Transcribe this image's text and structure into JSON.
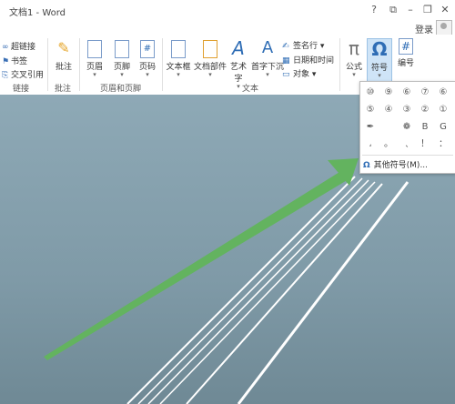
{
  "window": {
    "title": "文档1 - Word",
    "controls": [
      "?",
      "⧉",
      "–",
      "❐",
      "✕"
    ],
    "login": "登录"
  },
  "ribbon": {
    "links": {
      "items": [
        "超链接",
        "书签",
        "交叉引用"
      ],
      "group": "链接"
    },
    "comments": {
      "button": "批注",
      "group": "批注"
    },
    "header_footer": {
      "buttons": [
        "页眉",
        "页脚",
        "页码"
      ],
      "group": "页眉和页脚"
    },
    "text": {
      "buttons": [
        "文本框",
        "文档部件",
        "艺术字",
        "首字下沉"
      ],
      "group": "文本"
    },
    "text_right": {
      "items": [
        "签名行",
        "日期和时间",
        "对象"
      ]
    },
    "symbols": {
      "buttons": [
        "公式",
        "符号",
        "编号"
      ]
    }
  },
  "symbol_panel": {
    "symbols": [
      "⑩",
      "⑨",
      "⑥",
      "⑦",
      "⑥",
      "⑤",
      "④",
      "③",
      "②",
      "①",
      "✒",
      "",
      "❁",
      "B",
      "G",
      "،",
      "。",
      "﹑",
      "！",
      "："
    ],
    "more_label": "其他符号(M)..."
  },
  "colors": {
    "accent": "#2f6db5",
    "arrow": "#63b35f",
    "doc_bg": "#7f9aa7"
  }
}
